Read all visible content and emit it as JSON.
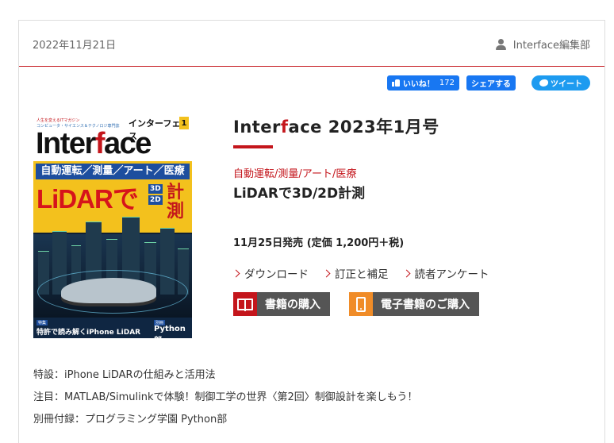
{
  "meta": {
    "date": "2022年11月21日",
    "author": "Interface編集部",
    "author_icon": "user-icon"
  },
  "social": {
    "like_label": "いいね！",
    "like_count": "172",
    "share_label": "シェアする",
    "tweet_label": "ツイート"
  },
  "cover": {
    "tagline": "人生を変えるITマガジン",
    "tagline2": "コンピュータ・サイエンス＆テクノロジ専門誌",
    "kana": "インターフェース",
    "issue": "1",
    "logo_pre": "Inter",
    "logo_f": "f",
    "logo_post": "ace",
    "tags": "自動運転／測量／アート／医療",
    "lidar": "LiDARで",
    "dim1": "3D",
    "dim2": "2D",
    "keisoku": "計測",
    "bottom_left": "特許で読み解くiPhone LiDAR",
    "bottom_right": "Python部"
  },
  "issue": {
    "title_pre": "Inter",
    "title_f": "f",
    "title_post": "ace 2023年1月号",
    "feature_tags": "自動運転/測量/アート/医療",
    "feature_title": "LiDARで3D/2D計測",
    "release": "11月25日発売 (定価 1,200円＋税)"
  },
  "links": [
    {
      "label": "ダウンロード"
    },
    {
      "label": "訂正と補足"
    },
    {
      "label": "読者アンケート"
    }
  ],
  "buy": {
    "print_label": "書籍の購入",
    "ebook_label": "電子書籍のご購入"
  },
  "contents": [
    "特設：iPhone LiDARの仕組みと活用法",
    "注目：MATLAB/Simulinkで体験！制御工学の世界〈第2回〉制御設計を楽しもう！",
    "別冊付録：プログラミング学園 Python部"
  ],
  "colors": {
    "accent": "#c4161c",
    "facebook": "#1877f2",
    "twitter": "#1d9bf0",
    "ebook": "#f08c28",
    "button": "#555555"
  }
}
